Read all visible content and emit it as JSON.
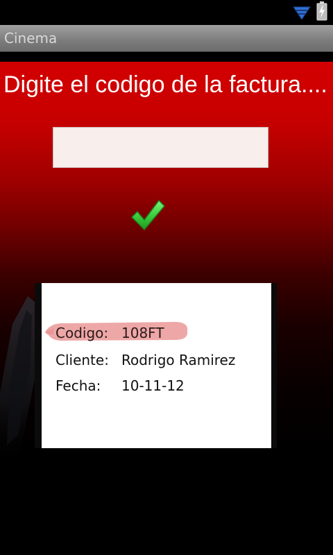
{
  "status_bar": {
    "icons": [
      "wifi-icon",
      "battery-charging-icon"
    ],
    "wifi_color": "#2f6fd6"
  },
  "app": {
    "title": "Cinema"
  },
  "form": {
    "prompt": "Digite el codigo de la factura....",
    "code_input_value": "",
    "code_input_placeholder": "",
    "submit_icon": "checkmark-icon",
    "submit_color": "#3ecf3e"
  },
  "receipt": {
    "codigo_label": "Codigo:",
    "codigo_value": "108FT",
    "cliente_label": "Cliente:",
    "cliente_value": "Rodrigo Ramirez",
    "fecha_label": "Fecha:",
    "fecha_value": "10-11-12",
    "highlight_color": "#e88a8a"
  },
  "colors": {
    "background_top": "#d40000",
    "background_bottom": "#000000"
  }
}
